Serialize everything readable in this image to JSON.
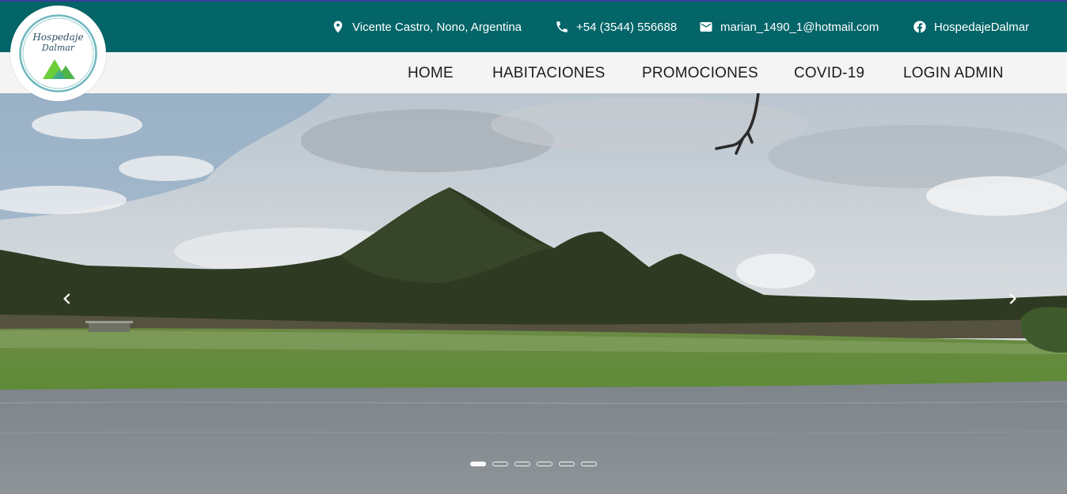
{
  "brand": {
    "logo_line1": "Hospedaje",
    "logo_line2": "Dalmar"
  },
  "contact": {
    "address": "Vicente Castro, Nono, Argentina",
    "phone": "+54 (3544) 556688",
    "email": "marian_1490_1@hotmail.com",
    "facebook": "HospedajeDalmar",
    "icons": [
      "map-pin-icon",
      "phone-icon",
      "mail-icon",
      "facebook-icon"
    ]
  },
  "nav": {
    "items": [
      {
        "label": "HOME"
      },
      {
        "label": "HABITACIONES"
      },
      {
        "label": "PROMOCIONES"
      },
      {
        "label": "COVID-19"
      },
      {
        "label": "LOGIN ADMIN"
      }
    ]
  },
  "carousel": {
    "slide_count": 6,
    "active_index": 0,
    "prev_icon": "chevron-left-icon",
    "next_icon": "chevron-right-icon"
  },
  "colors": {
    "topbar": "#036568",
    "navbar": "#f4f4f4",
    "accent_line": "#3b3f9a"
  }
}
